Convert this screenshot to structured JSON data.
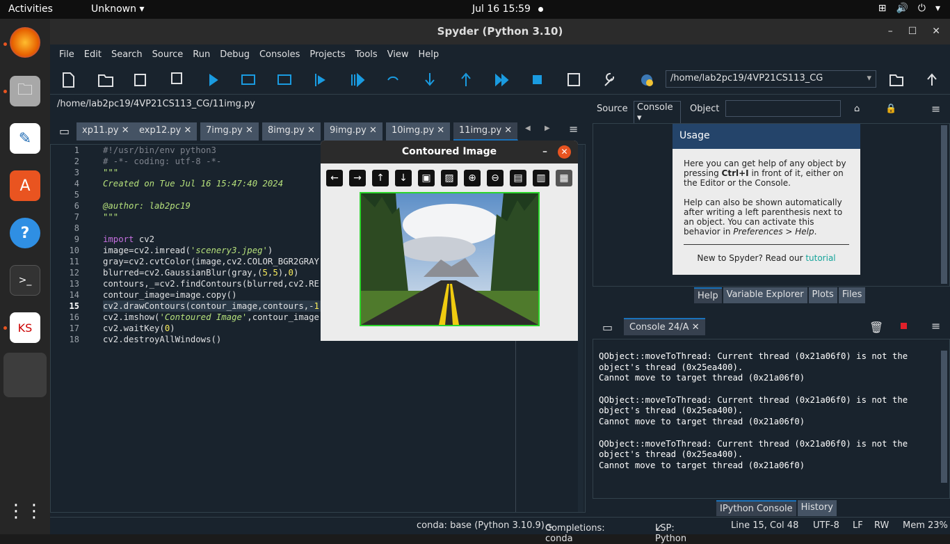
{
  "topbar": {
    "activities": "Activities",
    "app": "Unknown",
    "clock": "Jul 16  15:59"
  },
  "window": {
    "title": "Spyder (Python 3.10)"
  },
  "menu": [
    "File",
    "Edit",
    "Search",
    "Source",
    "Run",
    "Debug",
    "Consoles",
    "Projects",
    "Tools",
    "View",
    "Help"
  ],
  "toolbar": {
    "path": "/home/lab2pc19/4VP21CS113_CG"
  },
  "editor": {
    "filepath": "/home/lab2pc19/4VP21CS113_CG/11img.py",
    "tabs": [
      "xp11.py",
      "exp12.py",
      "7img.py",
      "8img.py",
      "9img.py",
      "10img.py",
      "11img.py"
    ],
    "line_numbers": [
      "1",
      "2",
      "3",
      "4",
      "5",
      "6",
      "7",
      "8",
      "9",
      "10",
      "11",
      "12",
      "13",
      "14",
      "15",
      "16",
      "17",
      "18"
    ],
    "current_line": "15"
  },
  "help": {
    "source_label": "Source",
    "source_value": "Console",
    "object_label": "Object",
    "usage_title": "Usage",
    "p1a": "Here you can get help of any object by pressing ",
    "p1b": "Ctrl+I",
    "p1c": " in front of it, either on the Editor or the Console.",
    "p2a": "Help can also be shown automatically after writing a left parenthesis next to an object. You can activate this behavior in ",
    "p2b": "Preferences > Help",
    "p3a": "New to Spyder? Read our ",
    "p3b": "tutorial",
    "tabs": [
      "Help",
      "Variable Explorer",
      "Plots",
      "Files"
    ]
  },
  "console": {
    "tab": "Console 24/A",
    "lines": [
      "QObject::moveToThread: Current thread (0x21a06f0) is not the",
      "object's thread (0x25ea400).",
      "Cannot move to target thread (0x21a06f0)",
      "",
      "QObject::moveToThread: Current thread (0x21a06f0) is not the",
      "object's thread (0x25ea400).",
      "Cannot move to target thread (0x21a06f0)",
      "",
      "QObject::moveToThread: Current thread (0x21a06f0) is not the",
      "object's thread (0x25ea400).",
      "Cannot move to target thread (0x21a06f0)"
    ],
    "tabs": [
      "IPython Console",
      "History"
    ]
  },
  "status": {
    "conda": "conda: base (Python 3.10.9)",
    "completions": "Completions: conda",
    "lsp": "LSP: Python",
    "pos": "Line 15, Col 48",
    "enc": "UTF-8",
    "eol": "LF",
    "rw": "RW",
    "mem": "Mem 23%"
  },
  "cvwindow": {
    "title": "Contoured Image"
  },
  "colors": {
    "accent": "#1a72bb",
    "bg": "#19232d",
    "ubuntu_orange": "#e95420"
  }
}
